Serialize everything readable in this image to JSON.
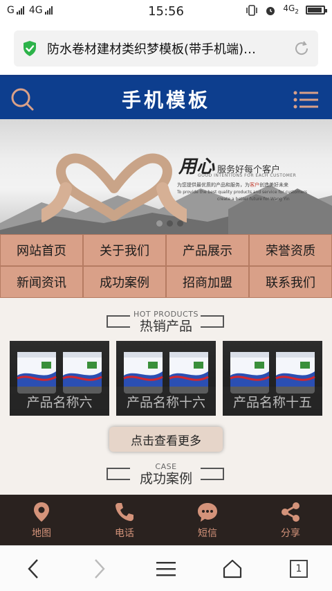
{
  "status_bar": {
    "carrier1": "G",
    "carrier2": "4G",
    "time": "15:56",
    "net": "4G",
    "net_sub": "2"
  },
  "browser": {
    "page_title": "防水卷材建材类织梦模板(带手机端)…"
  },
  "header": {
    "title": "手机模板"
  },
  "banner": {
    "headline_big": "用心",
    "headline": "服务好每个客户",
    "sub": "GOOD INTENTIONS FOR EACH CUSTOMER",
    "desc_line1_a": "为您提供最优质的产品和服务，为",
    "desc_line1_b": "客户",
    "desc_line1_c": "创造美好未来",
    "desc_line2": "To provide the best quality products and service for customers",
    "desc_line3": "create a better future for Wang Yin",
    "slides": 3,
    "active_slide": 1
  },
  "nav": {
    "items": [
      {
        "label": "网站首页"
      },
      {
        "label": "关于我们"
      },
      {
        "label": "产品展示"
      },
      {
        "label": "荣誉资质"
      },
      {
        "label": "新闻资讯"
      },
      {
        "label": "成功案例"
      },
      {
        "label": "招商加盟"
      },
      {
        "label": "联系我们"
      }
    ]
  },
  "hot_products": {
    "en": "HOT PRODUCTS",
    "cn": "热销产品",
    "items": [
      {
        "name": "产品名称六"
      },
      {
        "name": "产品名称十六"
      },
      {
        "name": "产品名称十五"
      }
    ],
    "more_label": "点击查看更多"
  },
  "case": {
    "en": "CASE",
    "cn": "成功案例"
  },
  "bottom_bar": {
    "items": [
      {
        "label": "地图",
        "icon": "map-pin-icon"
      },
      {
        "label": "电话",
        "icon": "phone-icon"
      },
      {
        "label": "短信",
        "icon": "sms-icon"
      },
      {
        "label": "分享",
        "icon": "share-icon"
      }
    ]
  },
  "browser_nav": {
    "tab_count": "1"
  },
  "colors": {
    "header_bg": "#0d3e8e",
    "nav_cell_bg": "#d9a088",
    "bottom_bar_bg": "#2a221f",
    "bottom_bar_accent": "#d4937a"
  }
}
